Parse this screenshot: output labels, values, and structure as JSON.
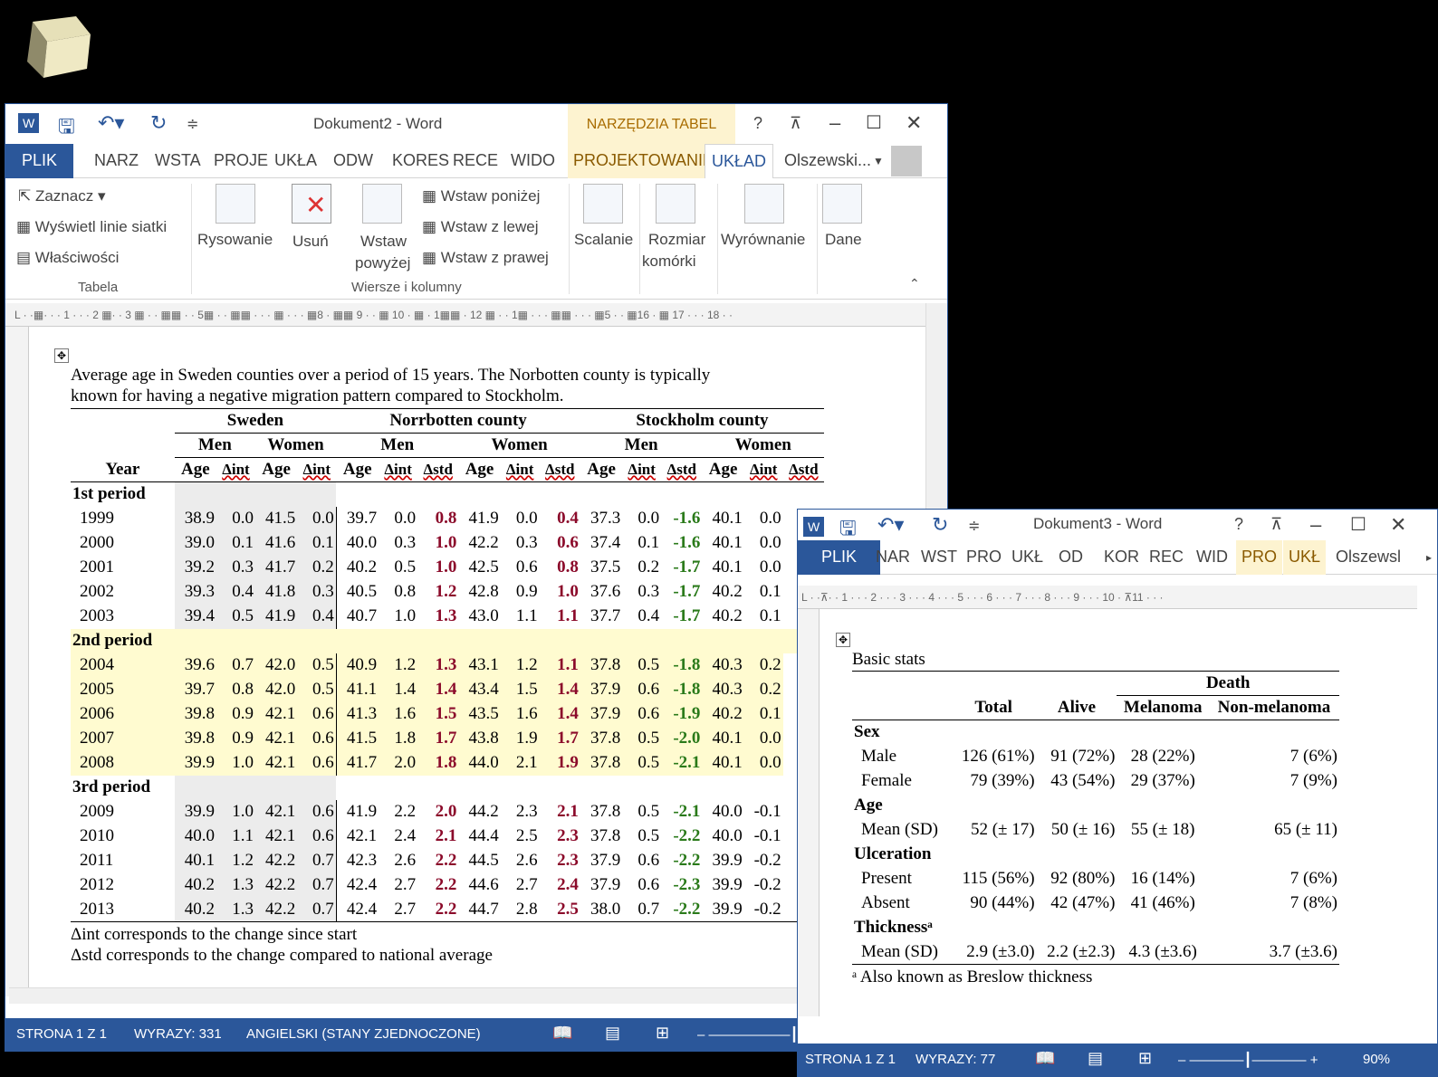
{
  "window1": {
    "title": "Dokument2 - Word",
    "context_band": "NARZĘDZIA TABEL",
    "help": "?",
    "tabs": [
      "PLIK",
      "NARZ",
      "WSTA",
      "PROJE",
      "UKŁA",
      "ODW",
      "KORES",
      "RECE",
      "WIDO",
      "PROJEKTOWANIE",
      "UKŁAD"
    ],
    "user": "Olszewski...",
    "ribbon": {
      "select": "Zaznacz",
      "gridlines": "Wyświetl linie siatki",
      "properties": "Właściwości",
      "group_table": "Tabela",
      "draw": "Rysowanie",
      "delete": "Usuń",
      "insert_above_1": "Wstaw",
      "insert_above_2": "powyżej",
      "insert_below": "Wstaw poniżej",
      "insert_left": "Wstaw z lewej",
      "insert_right": "Wstaw z prawej",
      "group_rows": "Wiersze i kolumny",
      "merge": "Scalanie",
      "cell_size_1": "Rozmiar",
      "cell_size_2": "komórki",
      "align": "Wyrównanie",
      "data": "Dane"
    },
    "ruler_text": "L · ·▦· · · 1 · · · 2 ▦· · 3 ▦ · · ▦▦ · · 5▦ · · ▦▦ · · · ▦ · · · ▦8 · ▦▦ 9 · · ▦ 10 · ▦ · 1▦▦ · 12 ▦ · · 1▦ · · · ▦▦ · · · ▦5 · · ▦16 · ▦ 17 · · · 18 · ·",
    "caption_1": "Average age in Sweden counties over a period of 15 years. The Norbotten county is typically",
    "caption_2": "known for having a negative migration pattern compared to Stockholm.",
    "table": {
      "groups": [
        "Sweden",
        "Norrbotten county",
        "Stockholm county"
      ],
      "sub": [
        "Men",
        "Women",
        "Men",
        "Women",
        "Men",
        "Women"
      ],
      "cols": [
        "Year",
        "Age",
        "Δint",
        "Age",
        "Δint",
        "Age",
        "Δint",
        "Δstd",
        "Age",
        "Δint",
        "Δstd",
        "Age",
        "Δint",
        "Δstd",
        "Age",
        "Δint",
        "Δstd"
      ],
      "periods": [
        {
          "label": "1st period",
          "rows": [
            [
              "1999",
              "38.9",
              "0.0",
              "41.5",
              "0.0",
              "39.7",
              "0.0",
              "0.8",
              "41.9",
              "0.0",
              "0.4",
              "37.3",
              "0.0",
              "-1.6",
              "40.1",
              "0.0"
            ],
            [
              "2000",
              "39.0",
              "0.1",
              "41.6",
              "0.1",
              "40.0",
              "0.3",
              "1.0",
              "42.2",
              "0.3",
              "0.6",
              "37.4",
              "0.1",
              "-1.6",
              "40.1",
              "0.0"
            ],
            [
              "2001",
              "39.2",
              "0.3",
              "41.7",
              "0.2",
              "40.2",
              "0.5",
              "1.0",
              "42.5",
              "0.6",
              "0.8",
              "37.5",
              "0.2",
              "-1.7",
              "40.1",
              "0.0"
            ],
            [
              "2002",
              "39.3",
              "0.4",
              "41.8",
              "0.3",
              "40.5",
              "0.8",
              "1.2",
              "42.8",
              "0.9",
              "1.0",
              "37.6",
              "0.3",
              "-1.7",
              "40.2",
              "0.1"
            ],
            [
              "2003",
              "39.4",
              "0.5",
              "41.9",
              "0.4",
              "40.7",
              "1.0",
              "1.3",
              "43.0",
              "1.1",
              "1.1",
              "37.7",
              "0.4",
              "-1.7",
              "40.2",
              "0.1"
            ]
          ]
        },
        {
          "label": "2nd period",
          "rows": [
            [
              "2004",
              "39.6",
              "0.7",
              "42.0",
              "0.5",
              "40.9",
              "1.2",
              "1.3",
              "43.1",
              "1.2",
              "1.1",
              "37.8",
              "0.5",
              "-1.8",
              "40.3",
              "0.2"
            ],
            [
              "2005",
              "39.7",
              "0.8",
              "42.0",
              "0.5",
              "41.1",
              "1.4",
              "1.4",
              "43.4",
              "1.5",
              "1.4",
              "37.9",
              "0.6",
              "-1.8",
              "40.3",
              "0.2"
            ],
            [
              "2006",
              "39.8",
              "0.9",
              "42.1",
              "0.6",
              "41.3",
              "1.6",
              "1.5",
              "43.5",
              "1.6",
              "1.4",
              "37.9",
              "0.6",
              "-1.9",
              "40.2",
              "0.1"
            ],
            [
              "2007",
              "39.8",
              "0.9",
              "42.1",
              "0.6",
              "41.5",
              "1.8",
              "1.7",
              "43.8",
              "1.9",
              "1.7",
              "37.8",
              "0.5",
              "-2.0",
              "40.1",
              "0.0"
            ],
            [
              "2008",
              "39.9",
              "1.0",
              "42.1",
              "0.6",
              "41.7",
              "2.0",
              "1.8",
              "44.0",
              "2.1",
              "1.9",
              "37.8",
              "0.5",
              "-2.1",
              "40.1",
              "0.0"
            ]
          ]
        },
        {
          "label": "3rd period",
          "rows": [
            [
              "2009",
              "39.9",
              "1.0",
              "42.1",
              "0.6",
              "41.9",
              "2.2",
              "2.0",
              "44.2",
              "2.3",
              "2.1",
              "37.8",
              "0.5",
              "-2.1",
              "40.0",
              "-0.1"
            ],
            [
              "2010",
              "40.0",
              "1.1",
              "42.1",
              "0.6",
              "42.1",
              "2.4",
              "2.1",
              "44.4",
              "2.5",
              "2.3",
              "37.8",
              "0.5",
              "-2.2",
              "40.0",
              "-0.1"
            ],
            [
              "2011",
              "40.1",
              "1.2",
              "42.2",
              "0.7",
              "42.3",
              "2.6",
              "2.2",
              "44.5",
              "2.6",
              "2.3",
              "37.9",
              "0.6",
              "-2.2",
              "39.9",
              "-0.2"
            ],
            [
              "2012",
              "40.2",
              "1.3",
              "42.2",
              "0.7",
              "42.4",
              "2.7",
              "2.2",
              "44.6",
              "2.7",
              "2.4",
              "37.9",
              "0.6",
              "-2.3",
              "39.9",
              "-0.2"
            ],
            [
              "2013",
              "40.2",
              "1.3",
              "42.2",
              "0.7",
              "42.4",
              "2.7",
              "2.2",
              "44.7",
              "2.8",
              "2.5",
              "38.0",
              "0.7",
              "-2.2",
              "39.9",
              "-0.2"
            ]
          ]
        }
      ]
    },
    "note_1": "Δint corresponds to the change since start",
    "note_2": "Δstd corresponds to the change compared to national average",
    "status_page": "STRONA 1 Z 1",
    "status_words": "WYRAZY: 331",
    "status_lang": "ANGIELSKI (STANY ZJEDNOCZONE)"
  },
  "window2": {
    "title": "Dokument3 - Word",
    "help": "?",
    "tabs": [
      "PLIK",
      "NAR",
      "WST",
      "PRO",
      "UKŁ",
      "OD",
      "KOR",
      "REC",
      "WID",
      "PRO",
      "UKŁ"
    ],
    "user": "Olszewsl",
    "ruler_text": "L · ·⊼· · 1 · · · 2 · · · 3 · · · 4 · · · 5 · · · 6 · · · 7 · · · 8 · · · 9 · · · 10 · ⊼11 · · ·",
    "caption": "Basic stats",
    "table": {
      "death": "Death",
      "headers": [
        "Total",
        "Alive",
        "Melanoma",
        "Non-melanoma"
      ],
      "sections": [
        {
          "label": "Sex",
          "rows": [
            [
              "Male",
              "126 (61%)",
              "91 (72%)",
              "28 (22%)",
              "7 (6%)"
            ],
            [
              "Female",
              "79 (39%)",
              "43 (54%)",
              "29 (37%)",
              "7 (9%)"
            ]
          ]
        },
        {
          "label": "Age",
          "rows": [
            [
              "Mean (SD)",
              "52 (± 17)",
              "50 (± 16)",
              "55 (± 18)",
              "65 (± 11)"
            ]
          ]
        },
        {
          "label": "Ulceration",
          "rows": [
            [
              "Present",
              "115 (56%)",
              "92 (80%)",
              "16 (14%)",
              "7 (6%)"
            ],
            [
              "Absent",
              "90 (44%)",
              "42 (47%)",
              "41 (46%)",
              "7 (8%)"
            ]
          ]
        },
        {
          "label": "Thicknessᵃ",
          "rows": [
            [
              "Mean (SD)",
              "2.9 (±3.0)",
              "2.2 (±2.3)",
              "4.3 (±3.6)",
              "3.7 (±3.6)"
            ]
          ]
        }
      ]
    },
    "footnote": "ᵃ Also known as Breslow thickness",
    "status_page": "STRONA 1 Z 1",
    "status_words": "WYRAZY: 77",
    "zoom": "90%"
  }
}
